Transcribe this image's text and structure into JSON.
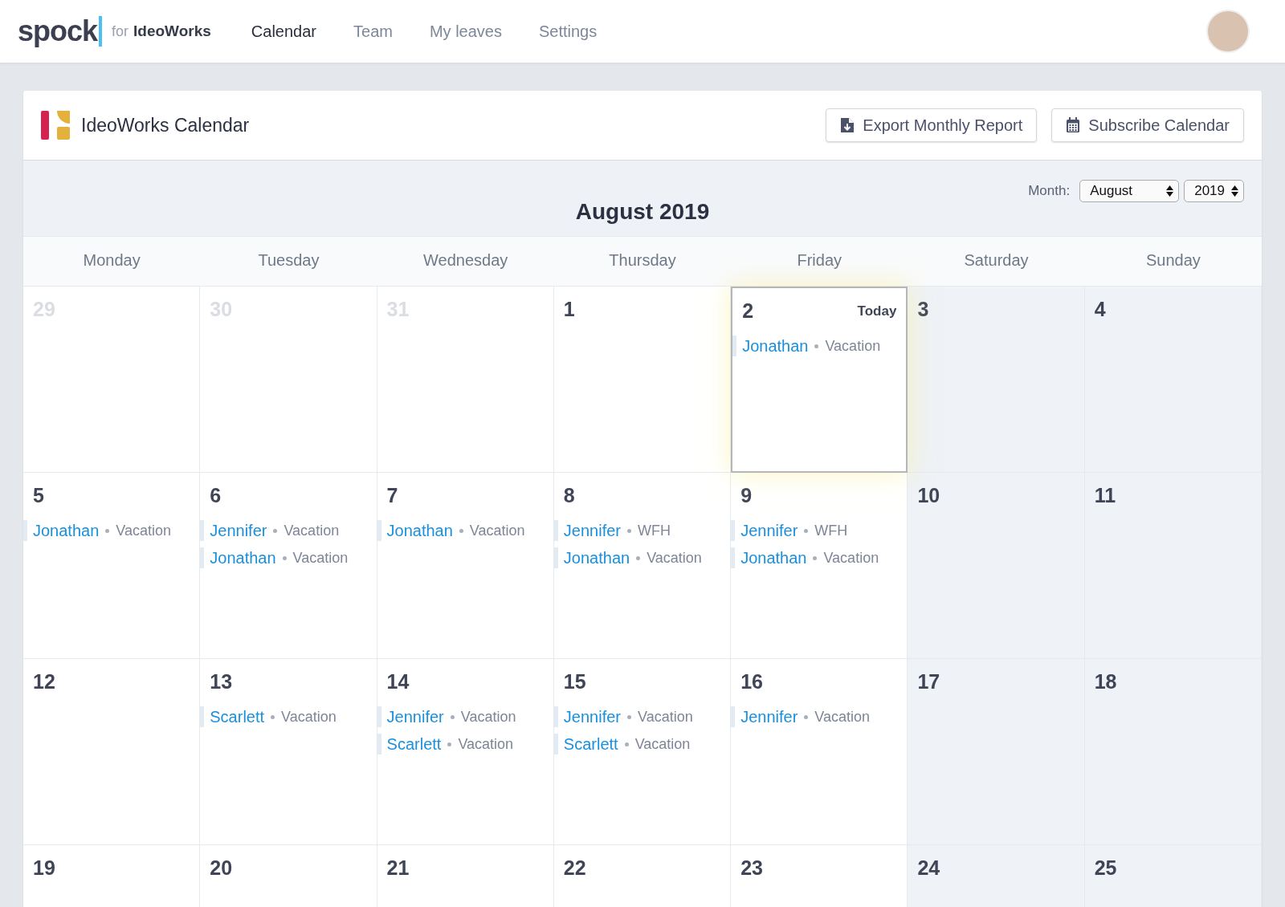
{
  "nav": {
    "brand": "spock",
    "for_label": "for",
    "org": "IdeoWorks",
    "links": [
      {
        "label": "Calendar",
        "selected": true
      },
      {
        "label": "Team",
        "selected": false
      },
      {
        "label": "My leaves",
        "selected": false
      },
      {
        "label": "Settings",
        "selected": false
      }
    ]
  },
  "card": {
    "title": "IdeoWorks Calendar",
    "buttons": [
      {
        "label": "Export Monthly Report",
        "kind": "export"
      },
      {
        "label": "Subscribe Calendar",
        "kind": "calendar"
      }
    ]
  },
  "month_picker": {
    "label": "Month:",
    "month": "August",
    "year": "2019"
  },
  "heading": "August 2019",
  "weekdays": [
    "Monday",
    "Tuesday",
    "Wednesday",
    "Thursday",
    "Friday",
    "Saturday",
    "Sunday"
  ],
  "weeks": [
    [
      {
        "day": "29",
        "muted": true,
        "weekend": false
      },
      {
        "day": "30",
        "muted": true,
        "weekend": false
      },
      {
        "day": "31",
        "muted": true,
        "weekend": false
      },
      {
        "day": "1",
        "muted": false,
        "weekend": false
      },
      {
        "day": "2",
        "muted": false,
        "weekend": false,
        "today": "Today",
        "events": [
          {
            "name": "Jonathan",
            "type": "Vacation"
          }
        ]
      },
      {
        "day": "3",
        "muted": false,
        "weekend": true
      },
      {
        "day": "4",
        "muted": false,
        "weekend": true
      }
    ],
    [
      {
        "day": "5",
        "muted": false,
        "weekend": false,
        "events": [
          {
            "name": "Jonathan",
            "type": "Vacation"
          }
        ]
      },
      {
        "day": "6",
        "muted": false,
        "weekend": false,
        "events": [
          {
            "name": "Jennifer",
            "type": "Vacation"
          },
          {
            "name": "Jonathan",
            "type": "Vacation"
          }
        ]
      },
      {
        "day": "7",
        "muted": false,
        "weekend": false,
        "events": [
          {
            "name": "Jonathan",
            "type": "Vacation"
          }
        ]
      },
      {
        "day": "8",
        "muted": false,
        "weekend": false,
        "events": [
          {
            "name": "Jennifer",
            "type": "WFH"
          },
          {
            "name": "Jonathan",
            "type": "Vacation"
          }
        ]
      },
      {
        "day": "9",
        "muted": false,
        "weekend": false,
        "events": [
          {
            "name": "Jennifer",
            "type": "WFH"
          },
          {
            "name": "Jonathan",
            "type": "Vacation"
          }
        ]
      },
      {
        "day": "10",
        "muted": false,
        "weekend": true
      },
      {
        "day": "11",
        "muted": false,
        "weekend": true
      }
    ],
    [
      {
        "day": "12",
        "muted": false,
        "weekend": false
      },
      {
        "day": "13",
        "muted": false,
        "weekend": false,
        "events": [
          {
            "name": "Scarlett",
            "type": "Vacation"
          }
        ]
      },
      {
        "day": "14",
        "muted": false,
        "weekend": false,
        "events": [
          {
            "name": "Jennifer",
            "type": "Vacation"
          },
          {
            "name": "Scarlett",
            "type": "Vacation"
          }
        ]
      },
      {
        "day": "15",
        "muted": false,
        "weekend": false,
        "events": [
          {
            "name": "Jennifer",
            "type": "Vacation"
          },
          {
            "name": "Scarlett",
            "type": "Vacation"
          }
        ]
      },
      {
        "day": "16",
        "muted": false,
        "weekend": false,
        "events": [
          {
            "name": "Jennifer",
            "type": "Vacation"
          }
        ]
      },
      {
        "day": "17",
        "muted": false,
        "weekend": true
      },
      {
        "day": "18",
        "muted": false,
        "weekend": true
      }
    ],
    [
      {
        "day": "19",
        "muted": false,
        "weekend": false
      },
      {
        "day": "20",
        "muted": false,
        "weekend": false
      },
      {
        "day": "21",
        "muted": false,
        "weekend": false
      },
      {
        "day": "22",
        "muted": false,
        "weekend": false
      },
      {
        "day": "23",
        "muted": false,
        "weekend": false
      },
      {
        "day": "24",
        "muted": false,
        "weekend": true
      },
      {
        "day": "25",
        "muted": false,
        "weekend": true
      }
    ]
  ]
}
